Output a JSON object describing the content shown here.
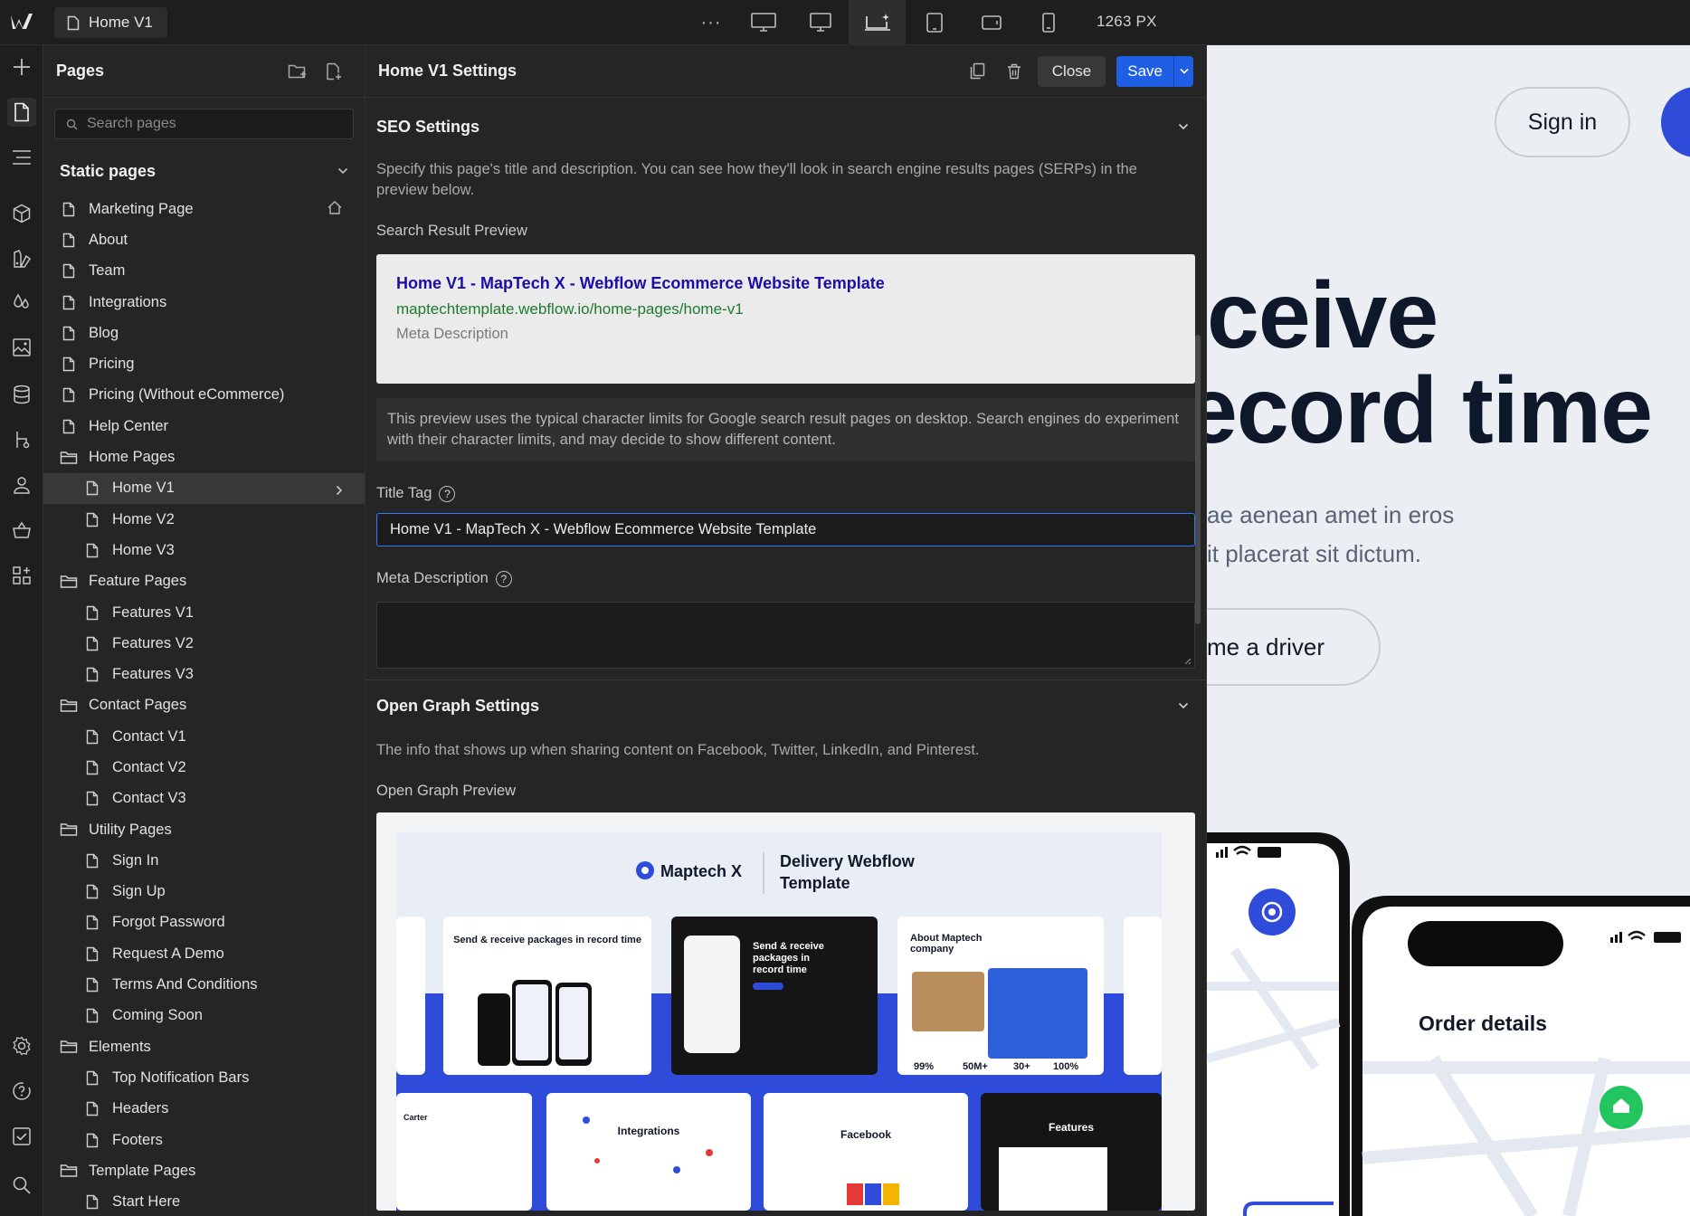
{
  "topbar": {
    "page_chip": "Home V1",
    "more": "···",
    "px_readout": "1263 PX"
  },
  "pages_panel": {
    "title": "Pages",
    "search_placeholder": "Search pages",
    "section_title": "Static pages",
    "items": [
      {
        "label": "Marketing Page",
        "type": "page",
        "level": 0,
        "home": true
      },
      {
        "label": "About",
        "type": "page",
        "level": 0
      },
      {
        "label": "Team",
        "type": "page",
        "level": 0
      },
      {
        "label": "Integrations",
        "type": "page",
        "level": 0
      },
      {
        "label": "Blog",
        "type": "page",
        "level": 0
      },
      {
        "label": "Pricing",
        "type": "page",
        "level": 0
      },
      {
        "label": "Pricing (Without eCommerce)",
        "type": "page",
        "level": 0
      },
      {
        "label": "Help Center",
        "type": "page",
        "level": 0
      },
      {
        "label": "Home Pages",
        "type": "folder",
        "level": 0
      },
      {
        "label": "Home V1",
        "type": "page",
        "level": 1,
        "selected": true
      },
      {
        "label": "Home V2",
        "type": "page",
        "level": 1
      },
      {
        "label": "Home V3",
        "type": "page",
        "level": 1
      },
      {
        "label": "Feature Pages",
        "type": "folder",
        "level": 0
      },
      {
        "label": "Features V1",
        "type": "page",
        "level": 1
      },
      {
        "label": "Features V2",
        "type": "page",
        "level": 1
      },
      {
        "label": "Features V3",
        "type": "page",
        "level": 1
      },
      {
        "label": "Contact Pages",
        "type": "folder",
        "level": 0
      },
      {
        "label": "Contact V1",
        "type": "page",
        "level": 1
      },
      {
        "label": "Contact V2",
        "type": "page",
        "level": 1
      },
      {
        "label": "Contact V3",
        "type": "page",
        "level": 1
      },
      {
        "label": "Utility Pages",
        "type": "folder",
        "level": 0
      },
      {
        "label": "Sign In",
        "type": "page",
        "level": 1
      },
      {
        "label": "Sign Up",
        "type": "page",
        "level": 1
      },
      {
        "label": "Forgot Password",
        "type": "page",
        "level": 1
      },
      {
        "label": "Request A Demo",
        "type": "page",
        "level": 1
      },
      {
        "label": "Terms And Conditions",
        "type": "page",
        "level": 1
      },
      {
        "label": "Coming Soon",
        "type": "page",
        "level": 1
      },
      {
        "label": "Elements",
        "type": "folder",
        "level": 0
      },
      {
        "label": "Top Notification Bars",
        "type": "page",
        "level": 1
      },
      {
        "label": "Headers",
        "type": "page",
        "level": 1
      },
      {
        "label": "Footers",
        "type": "page",
        "level": 1
      },
      {
        "label": "Template Pages",
        "type": "folder",
        "level": 0
      },
      {
        "label": "Start Here",
        "type": "page",
        "level": 1
      }
    ]
  },
  "settings": {
    "title": "Home V1 Settings",
    "close_label": "Close",
    "save_label": "Save",
    "seo": {
      "title": "SEO Settings",
      "description": "Specify this page's title and description. You can see how they'll look in search engine results pages (SERPs) in the preview below.",
      "preview_label": "Search Result Preview",
      "serp_title": "Home V1 - MapTech X - Webflow Ecommerce Website Template",
      "serp_url": "maptechtemplate.webflow.io/home-pages/home-v1",
      "serp_desc": "Meta Description",
      "note": "This preview uses the typical character limits for Google search result pages on desktop. Search engines do experiment with their character limits, and may decide to show different content.",
      "title_tag_label": "Title Tag",
      "title_tag_value": "Home V1 - MapTech X - Webflow Ecommerce Website Template",
      "meta_desc_label": "Meta Description",
      "meta_desc_value": ""
    },
    "og": {
      "title": "Open Graph Settings",
      "description": "The info that shows up when sharing content on Facebook, Twitter, LinkedIn, and Pinterest.",
      "preview_label": "Open Graph Preview",
      "brand": "Maptech X",
      "tagline_line1": "Delivery Webflow",
      "tagline_line2": "Template",
      "thumbs": {
        "send_receive": "Send & receive packages in record time",
        "dark_line1": "Send & receive",
        "dark_line2": "packages in",
        "dark_line3": "record time",
        "about_line1": "About Maptech",
        "about_line2": "company",
        "stat1": "99%",
        "stat2": "50M+",
        "stat3": "30+",
        "stat4": "100%",
        "integrations": "Integrations",
        "facebook": "Facebook",
        "features": "Features",
        "carter": "Carter"
      }
    }
  },
  "preview": {
    "signin": "Sign in",
    "hero_line1": "ceive",
    "hero_line2": "ecord time",
    "lead_line1": "ae aenean amet in eros",
    "lead_line2": "it placerat sit dictum.",
    "driver_btn": "me a driver",
    "order_details": "Order details"
  },
  "colors": {
    "accent": "#1f5fe6",
    "serp_title": "#1a0dab",
    "serp_url": "#1e7a2e",
    "brand_blue": "#2f4bd9"
  }
}
